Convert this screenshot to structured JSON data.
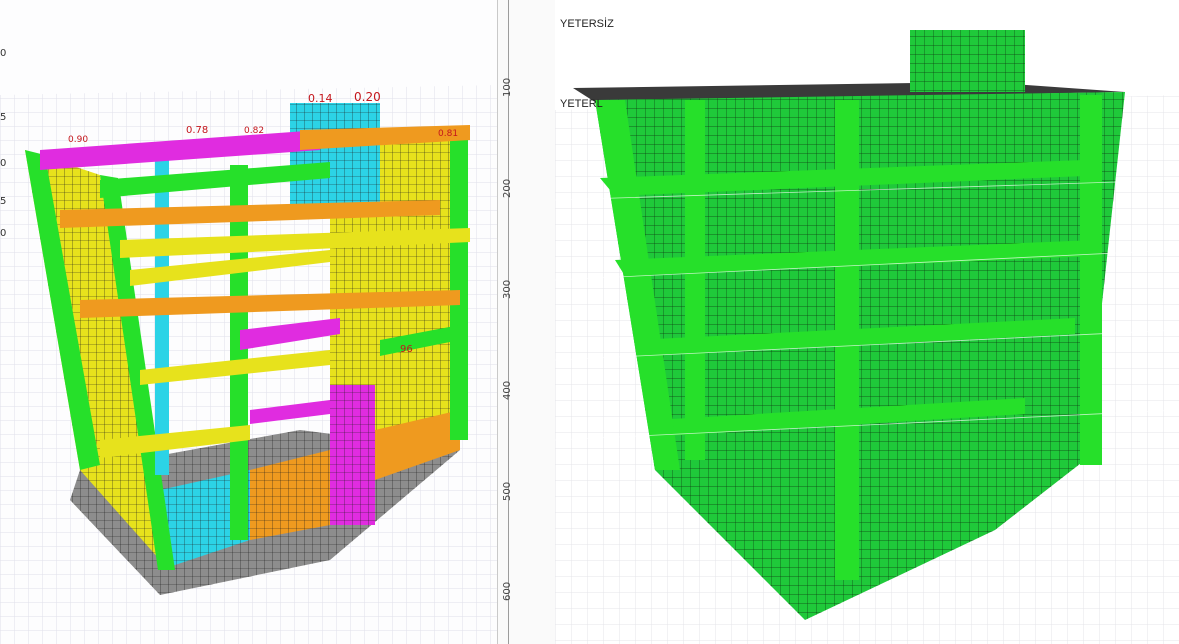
{
  "left_view": {
    "edge_numbers": [
      "0",
      "5",
      "0",
      "5",
      "0"
    ],
    "ratio_labels": [
      "0.14",
      "0.20",
      "0.78",
      "0.81",
      "0.90",
      "0.82",
      "96"
    ]
  },
  "ruler": {
    "ticks": [
      "100",
      "200",
      "300",
      "400",
      "500",
      "600"
    ]
  },
  "right_view": {
    "status_label_top": "YETERSİZ",
    "status_label_second": "YETERL"
  },
  "colors": {
    "green": "#26e02a",
    "magenta": "#e02ce0",
    "cyan": "#2cd3e6",
    "yellow": "#e7e21c",
    "orange": "#ef9a1f",
    "gray_slab": "#8d8d8d",
    "ratio_red": "#c4161c",
    "mesh_green": "#1fc93a"
  }
}
